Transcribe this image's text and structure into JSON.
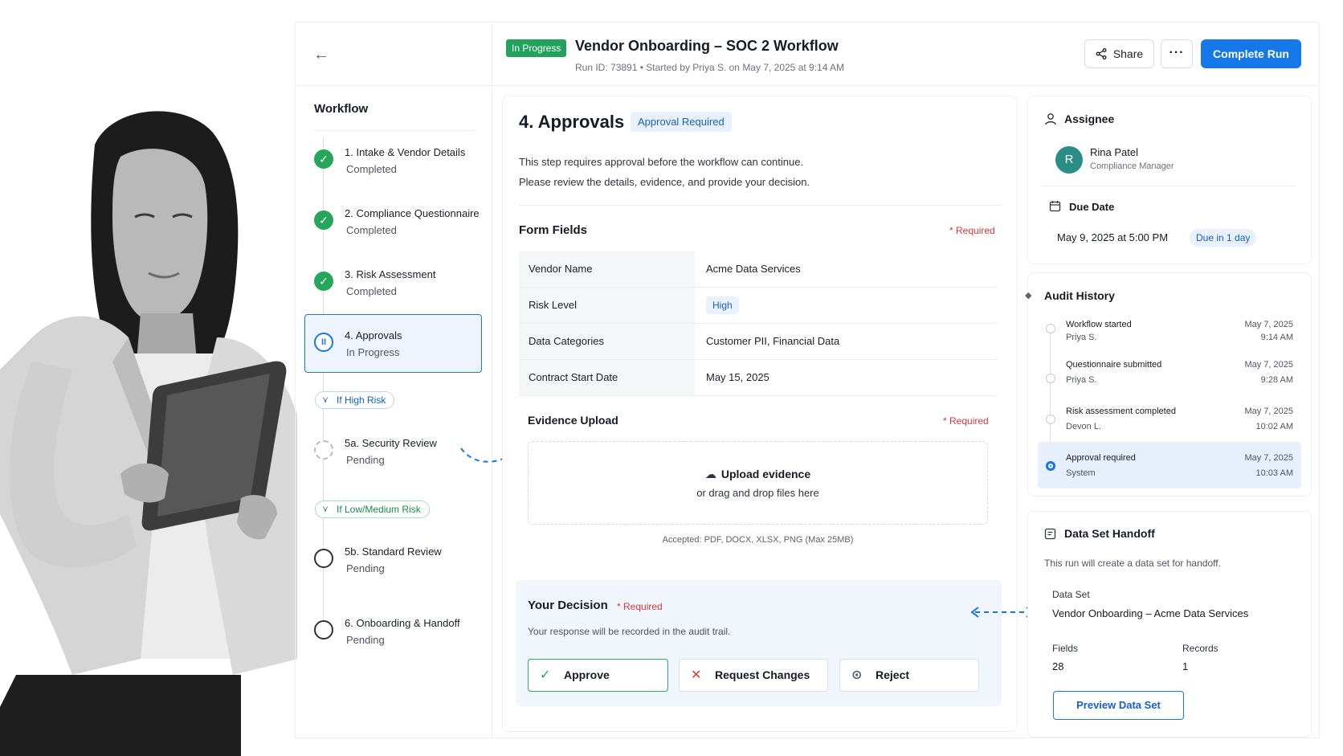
{
  "header": {
    "status": "In Progress",
    "title": "Vendor Onboarding – SOC 2 Workflow",
    "meta": "Run ID: 73891  •  Started by Priya S. on May 7, 2025 at 9:14 AM",
    "share_label": "Share",
    "more_label": "···",
    "complete_label": "Complete Run"
  },
  "sidebar": {
    "title": "Workflow",
    "steps": [
      {
        "label": "1. Intake & Vendor Details",
        "status": "Completed"
      },
      {
        "label": "2. Compliance Questionnaire",
        "status": "Completed"
      },
      {
        "label": "3. Risk Assessment",
        "status": "Completed"
      },
      {
        "label": "4. Approvals",
        "status": "In Progress"
      },
      {
        "label": "5a. Security Review",
        "status": "Pending"
      },
      {
        "label": "5b. Standard Review",
        "status": "Pending"
      },
      {
        "label": "6. Onboarding & Handoff",
        "status": "Pending"
      }
    ],
    "branch_high": "If High Risk",
    "branch_low": "If Low/Medium Risk"
  },
  "main": {
    "step_title": "4. Approvals",
    "badge": "Approval Required",
    "desc_line1": "This step requires approval before the workflow can continue.",
    "desc_line2": "Please review the details, evidence, and provide your decision.",
    "form_fields_title": "Form Fields",
    "required": "* Required",
    "fields": [
      {
        "key": "Vendor Name",
        "value": "Acme Data Services"
      },
      {
        "key": "Risk Level",
        "value": "High"
      },
      {
        "key": "Data Categories",
        "value": "Customer PII, Financial Data"
      },
      {
        "key": "Contract Start Date",
        "value": "May 15, 2025"
      }
    ],
    "evidence_title": "Evidence Upload",
    "upload_title": "Upload evidence",
    "upload_sub": "or drag and drop files here",
    "accepted": "Accepted: PDF, DOCX, XLSX, PNG (Max 25MB)",
    "decision_title": "Your Decision",
    "decision_sub": "Your response will be recorded in the audit trail.",
    "approve_label": "Approve",
    "changes_label": "Request Changes",
    "reject_label": "Reject"
  },
  "assignee": {
    "title": "Assignee",
    "initial": "R",
    "name": "Rina Patel",
    "role": "Compliance Manager",
    "due_title": "Due Date",
    "due_date": "May 9, 2025 at 5:00 PM",
    "due_badge": "Due in 1 day"
  },
  "audit": {
    "title": "Audit History",
    "items": [
      {
        "event": "Workflow started",
        "who": "Priya S.",
        "date": "May 7, 2025",
        "time": "9:14 AM"
      },
      {
        "event": "Questionnaire submitted",
        "who": "Priya S.",
        "date": "May 7, 2025",
        "time": "9:28 AM"
      },
      {
        "event": "Risk assessment completed",
        "who": "Devon L.",
        "date": "May 7, 2025",
        "time": "10:02 AM"
      },
      {
        "event": "Approval required",
        "who": "System",
        "date": "May 7, 2025",
        "time": "10:03 AM"
      }
    ]
  },
  "handoff": {
    "title": "Data Set Handoff",
    "desc": "This run will create a data set for handoff.",
    "dataset_label": "Data Set",
    "dataset_value": "Vendor Onboarding – Acme Data Services",
    "fields_label": "Fields",
    "fields_value": "28",
    "records_label": "Records",
    "records_value": "1",
    "preview_label": "Preview Data Set"
  },
  "colors": {
    "accent": "#1677e8",
    "success": "#26a65b",
    "danger": "#d43b3b"
  }
}
